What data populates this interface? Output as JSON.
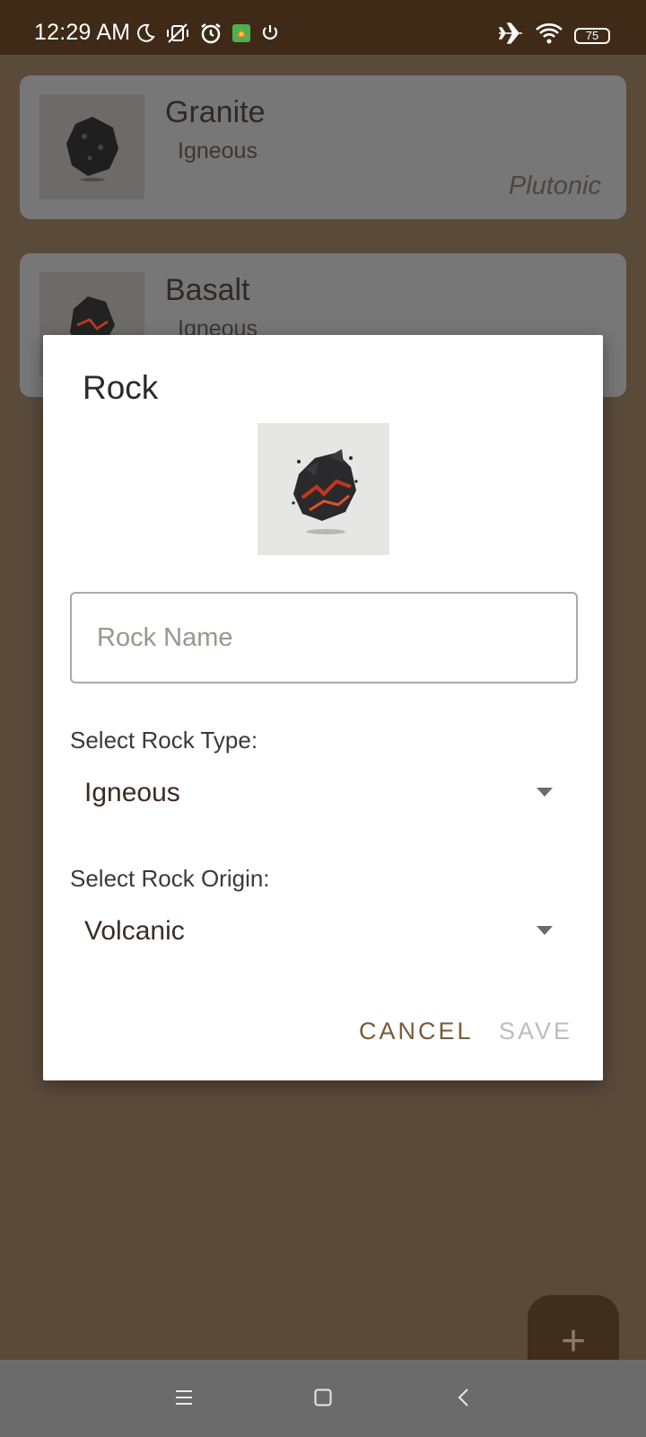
{
  "status_bar": {
    "time": "12:29 AM",
    "battery": "75",
    "icons_left": [
      "moon-icon",
      "vibrate-off-icon",
      "alarm-icon",
      "app-notification-icon",
      "power-icon"
    ],
    "icons_right": [
      "airplane-icon",
      "wifi-icon",
      "battery-icon"
    ]
  },
  "rocks": [
    {
      "name": "Granite",
      "type": "Igneous",
      "origin": "Plutonic"
    },
    {
      "name": "Basalt",
      "type": "Igneous",
      "origin": ""
    }
  ],
  "dialog": {
    "title": "Rock",
    "name_placeholder": "Rock Name",
    "name_value": "",
    "type_label": "Select Rock Type:",
    "type_value": "Igneous",
    "origin_label": "Select Rock Origin:",
    "origin_value": "Volcanic",
    "cancel_label": "CANCEL",
    "save_label": "SAVE"
  },
  "fab": {
    "icon": "plus-icon",
    "label": "+"
  },
  "nav": {
    "items": [
      "menu-icon",
      "home-icon",
      "back-icon"
    ]
  },
  "colors": {
    "accent": "#7a5a36",
    "status_bar": "#3f2a18",
    "scrim_background": "#5a4a3a",
    "disabled": "#bdbdbd"
  }
}
